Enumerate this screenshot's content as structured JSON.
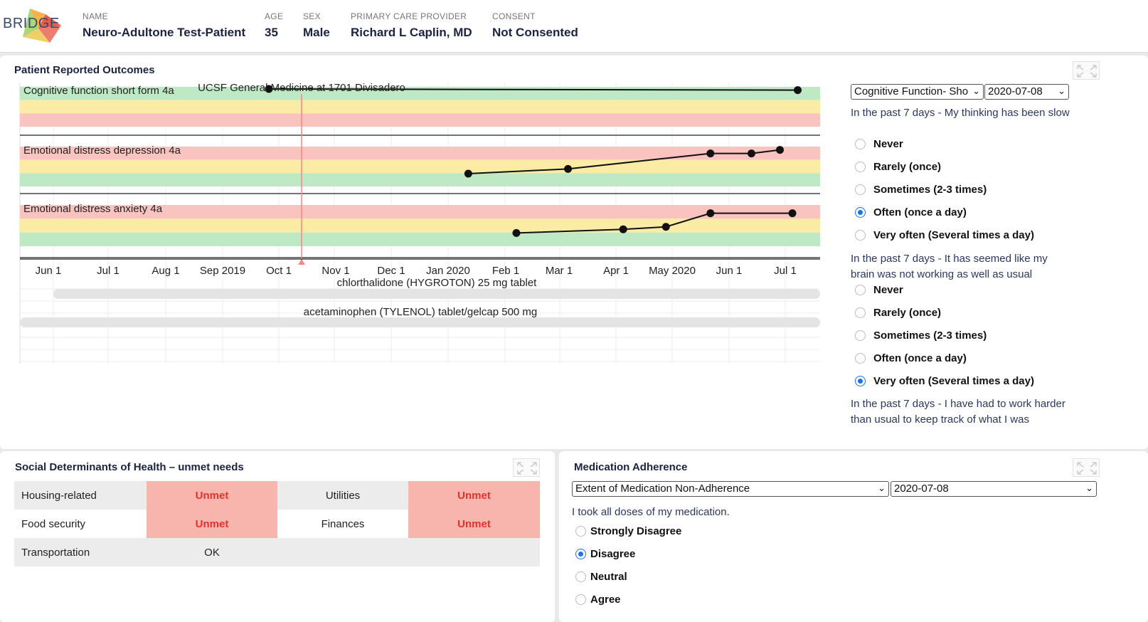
{
  "header": {
    "logo_text": "BRIDGE",
    "fields": [
      {
        "label": "NAME",
        "value": "Neuro-Adultone Test-Patient"
      },
      {
        "label": "AGE",
        "value": "35"
      },
      {
        "label": "SEX",
        "value": "Male"
      },
      {
        "label": "PRIMARY CARE PROVIDER",
        "value": "Richard L Caplin, MD"
      },
      {
        "label": "CONSENT",
        "value": "Not Consented"
      }
    ]
  },
  "pro": {
    "title": "Patient Reported Outcomes",
    "encounter_label": "UCSF General Medicine at 1701 Divisadero",
    "charts": [
      {
        "label": "Cognitive function short form 4a"
      },
      {
        "label": "Emotional distress depression 4a"
      },
      {
        "label": "Emotional distress anxiety 4a"
      }
    ],
    "medications": [
      {
        "name": "chlorthalidone (HYGROTON) 25 mg tablet"
      },
      {
        "name": "acetaminophen (TYLENOL) tablet/gelcap 500 mg"
      }
    ],
    "axis_ticks": [
      "Jun 1",
      "Jul 1",
      "Aug 1",
      "Sep 2019",
      "Oct 1",
      "Nov 1",
      "Dec 1",
      "Jan 2020",
      "Feb 1",
      "Mar 1",
      "Apr 1",
      "May 2020",
      "Jun 1",
      "Jul 1"
    ],
    "questionnaire_select": "Cognitive Function- Sho",
    "date_select": "2020-07-08",
    "questions": [
      {
        "text": "In the past 7 days - My thinking has been slow",
        "options": [
          "Never",
          "Rarely (once)",
          "Sometimes (2-3 times)",
          "Often (once a day)",
          "Very often (Several times a day)"
        ],
        "selected": "Often (once a day)"
      },
      {
        "text": "In the past 7 days - It has seemed like my brain was not working as well as usual",
        "options": [
          "Never",
          "Rarely (once)",
          "Sometimes (2-3 times)",
          "Often (once a day)",
          "Very often (Several times a day)"
        ],
        "selected": "Very often (Several times a day)"
      },
      {
        "text": "In the past 7 days - I have had to work harder than usual to keep track of what I was"
      }
    ]
  },
  "chart_data": [
    {
      "type": "line",
      "title": "Cognitive function short form 4a",
      "x": [
        "2019-09-15",
        "2020-07-08"
      ],
      "series": [
        {
          "values": [
            3,
            2.9
          ]
        }
      ],
      "bands": [
        "green",
        "yellow",
        "red"
      ]
    },
    {
      "type": "line",
      "title": "Emotional distress depression 4a",
      "x": [
        "2020-01-05",
        "2020-03-01",
        "2020-05-20",
        "2020-06-12",
        "2020-06-28"
      ],
      "series": [
        {
          "values": [
            0.9,
            1.3,
            2.6,
            2.6,
            2.9
          ]
        }
      ],
      "bands": [
        "red",
        "yellow",
        "green"
      ]
    },
    {
      "type": "line",
      "title": "Emotional distress anxiety 4a",
      "x": [
        "2020-02-01",
        "2020-04-01",
        "2020-04-25",
        "2020-05-20",
        "2020-07-05"
      ],
      "series": [
        {
          "values": [
            0.9,
            1.2,
            1.4,
            2.5,
            2.5
          ]
        }
      ],
      "bands": [
        "red",
        "yellow",
        "green"
      ]
    }
  ],
  "sdoh": {
    "title": "Social Determinants of Health – unmet needs",
    "rows": [
      {
        "c1": "Housing-related",
        "c2": "Unmet",
        "c3": "Utilities",
        "c4": "Unmet"
      },
      {
        "c1": "Food security",
        "c2": "Unmet",
        "c3": "Finances",
        "c4": "Unmet"
      },
      {
        "c1": "Transportation",
        "c2": "OK"
      }
    ]
  },
  "adherence": {
    "title": "Medication Adherence",
    "questionnaire_select": "Extent of Medication Non-Adherence",
    "date_select": "2020-07-08",
    "question": "I took all doses of my medication.",
    "options": [
      "Strongly Disagree",
      "Disagree",
      "Neutral",
      "Agree"
    ],
    "selected": "Disagree"
  },
  "colors": {
    "band_green": "#bfe8c4",
    "band_yellow": "#faeba5",
    "band_red": "#f9c3c0",
    "unmet_bg": "#f7b5ae",
    "unmet_text": "#e0332b",
    "radio_accent": "#1a73e8",
    "encounter_line": "#f08a80"
  }
}
